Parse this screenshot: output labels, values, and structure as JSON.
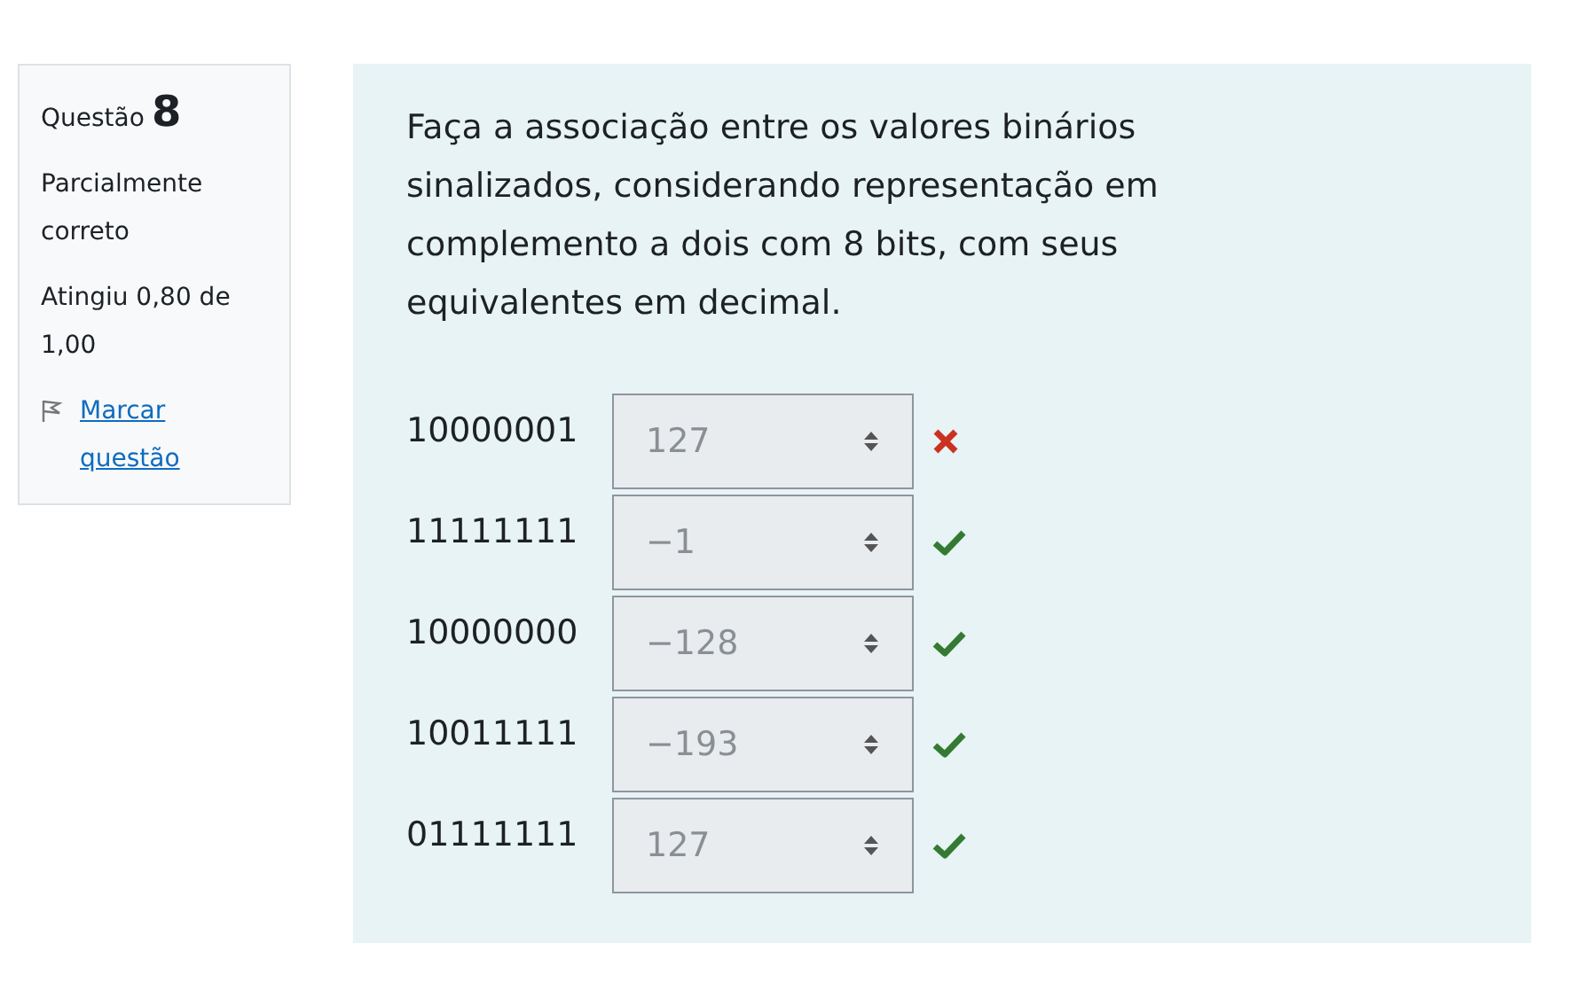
{
  "info": {
    "label": "Questão",
    "number": "8",
    "state": "Parcialmente correto",
    "grade": "Atingiu 0,80 de 1,00",
    "flag_link": "Marcar questão"
  },
  "question": {
    "text": "Faça a associação entre os valores binários sinalizados, considerando representação em complemento a dois com 8 bits, com seus equivalentes em decimal.",
    "rows": [
      {
        "binary": "10000001",
        "answer": "127",
        "correct": false
      },
      {
        "binary": "11111111",
        "answer": "−1",
        "correct": true
      },
      {
        "binary": "10000000",
        "answer": "−128",
        "correct": true
      },
      {
        "binary": "10011111",
        "answer": "−193",
        "correct": true
      },
      {
        "binary": "01111111",
        "answer": "127",
        "correct": true
      }
    ]
  }
}
